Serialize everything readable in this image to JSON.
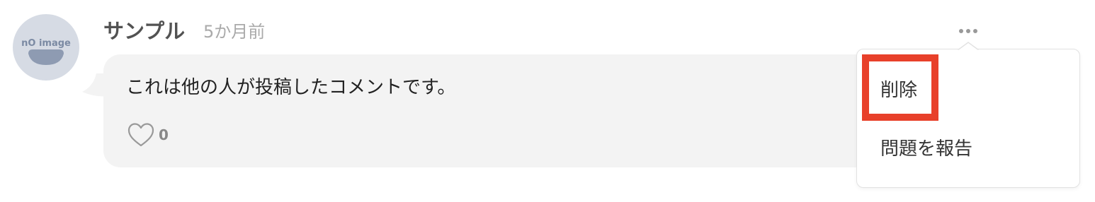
{
  "comment": {
    "avatar_text": "nO imagе",
    "username": "サンプル",
    "timestamp": "5か月前",
    "body": "これは他の人が投稿したコメントです。",
    "like_count": "0",
    "more_icon": "more-horizontal-icon",
    "like_icon": "heart-outline-icon"
  },
  "menu": {
    "items": [
      {
        "label": "削除",
        "highlighted": true
      },
      {
        "label": "問題を報告",
        "highlighted": false
      }
    ]
  },
  "colors": {
    "bubble_bg": "#f3f3f3",
    "avatar_bg": "#d6dbe4",
    "avatar_fg": "#7b8aa3",
    "highlight": "#e8402a",
    "username": "#525252",
    "timestamp": "#aaaaaa"
  }
}
